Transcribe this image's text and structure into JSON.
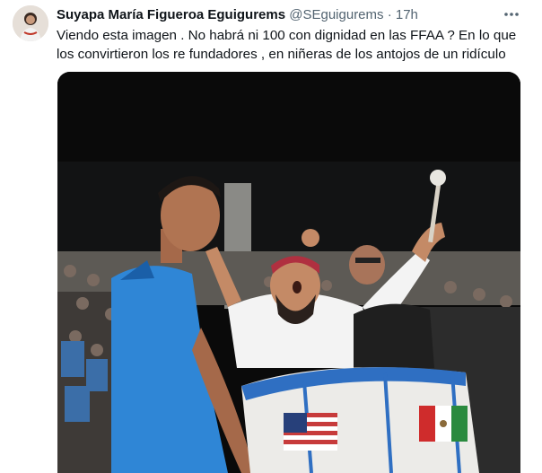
{
  "tweet": {
    "author_name": "Suyapa María Figueroa Eguigurems",
    "handle": "@SEguigurems",
    "separator": "·",
    "time": "17h",
    "more_icon": "more-horizontal-icon",
    "text_line_1": "Viendo esta imagen . No habrá ni 100 con dignidad en las FFAA ? En lo que",
    "text_line_2": "los convirtieron los re fundadores , en niñeras de los antojos de un ridículo"
  },
  "colors": {
    "text_primary": "#0f1419",
    "text_secondary": "#536471",
    "jersey_blue": "#2f86d6"
  }
}
